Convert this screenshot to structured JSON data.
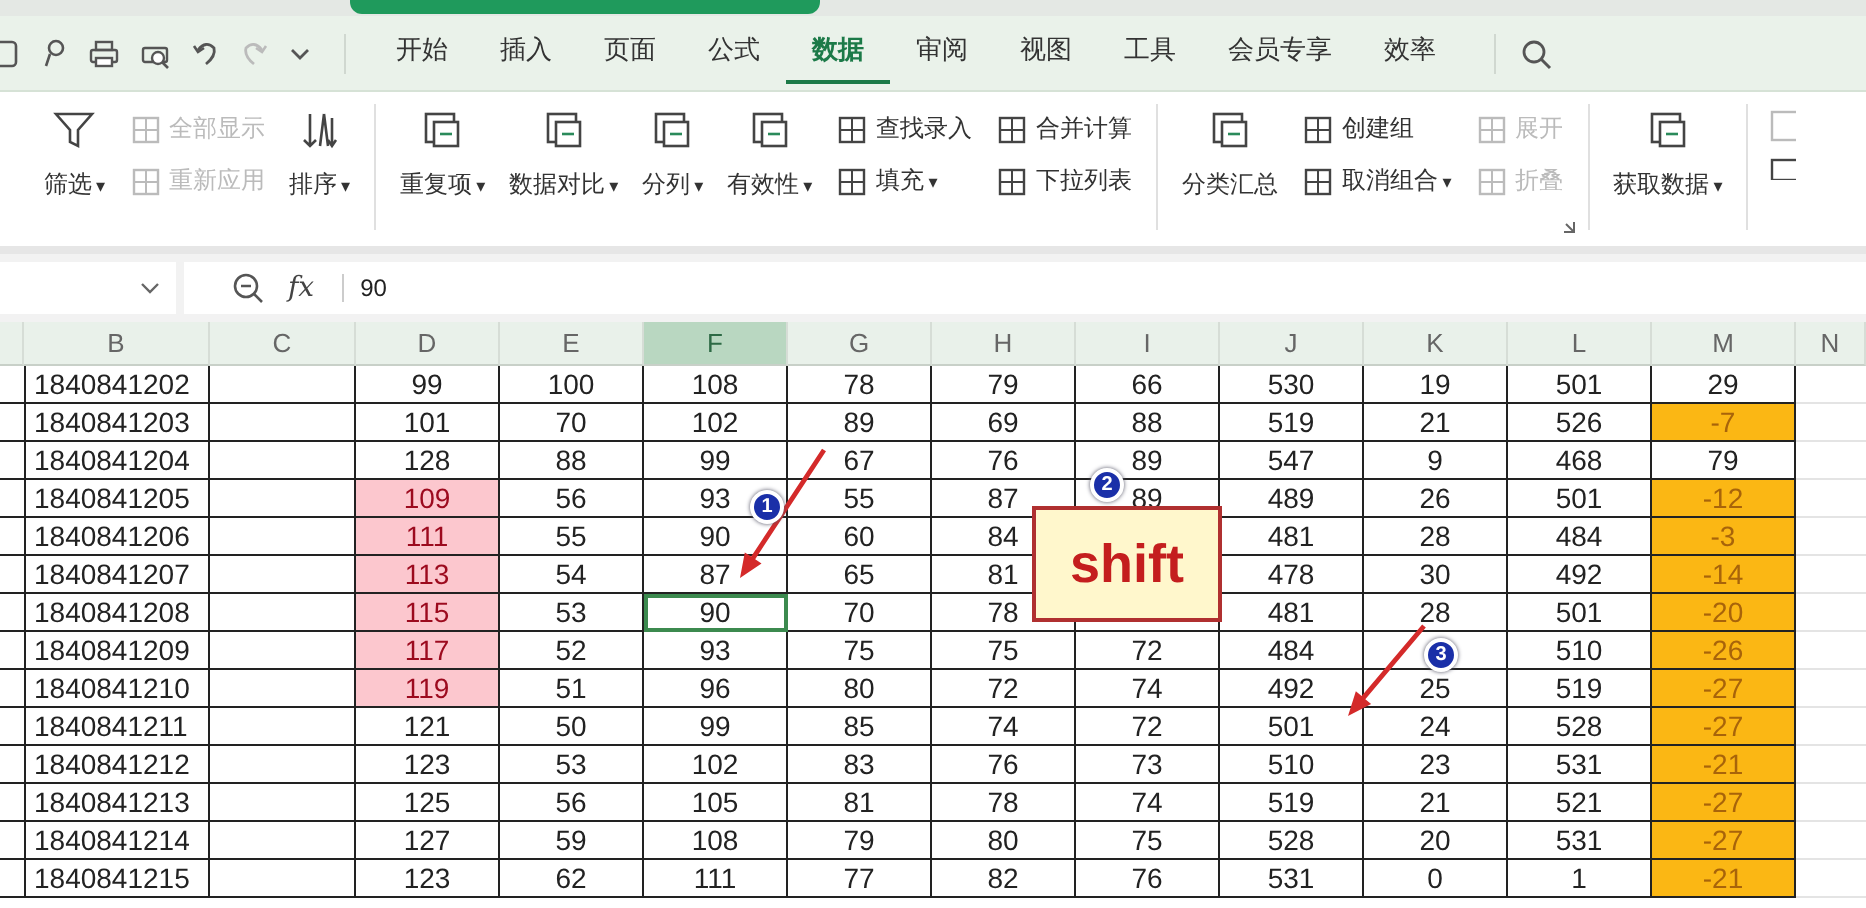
{
  "menu_tabs": [
    {
      "label": "开始",
      "selected": false
    },
    {
      "label": "插入",
      "selected": false
    },
    {
      "label": "页面",
      "selected": false
    },
    {
      "label": "公式",
      "selected": false
    },
    {
      "label": "数据",
      "selected": true
    },
    {
      "label": "审阅",
      "selected": false
    },
    {
      "label": "视图",
      "selected": false
    },
    {
      "label": "工具",
      "selected": false
    },
    {
      "label": "会员专享",
      "selected": false
    },
    {
      "label": "效率",
      "selected": false
    }
  ],
  "ribbon": [
    {
      "items": [
        {
          "kind": "large",
          "label": "筛选",
          "caret": "▾",
          "disabled": false
        },
        {
          "kind": "stack",
          "items": [
            {
              "label": "全部显示",
              "disabled": true
            },
            {
              "label": "重新应用",
              "disabled": true
            }
          ]
        },
        {
          "kind": "large",
          "label": "排序",
          "caret": "▾",
          "disabled": false
        }
      ]
    },
    {
      "items": [
        {
          "kind": "large",
          "label": "重复项",
          "caret": "▾",
          "disabled": false
        },
        {
          "kind": "large",
          "label": "数据对比",
          "caret": "▾",
          "disabled": false
        },
        {
          "kind": "large",
          "label": "分列",
          "caret": "▾",
          "disabled": false
        },
        {
          "kind": "large",
          "label": "有效性",
          "caret": "▾",
          "disabled": false
        },
        {
          "kind": "stack",
          "items": [
            {
              "label": "查找录入",
              "disabled": false
            },
            {
              "label": "填充",
              "caret": "▾",
              "disabled": false
            }
          ]
        },
        {
          "kind": "stack",
          "items": [
            {
              "label": "合并计算",
              "disabled": false
            },
            {
              "label": "下拉列表",
              "disabled": false
            }
          ]
        }
      ]
    },
    {
      "items": [
        {
          "kind": "large",
          "label": "分类汇总",
          "disabled": false
        },
        {
          "kind": "stack",
          "items": [
            {
              "label": "创建组",
              "disabled": false
            },
            {
              "label": "取消组合",
              "caret": "▾",
              "disabled": false
            }
          ]
        },
        {
          "kind": "stack",
          "items": [
            {
              "label": "展开",
              "disabled": true
            },
            {
              "label": "折叠",
              "disabled": true
            }
          ]
        }
      ]
    },
    {
      "items": [
        {
          "kind": "large",
          "label": "获取数据",
          "caret": "▾",
          "disabled": false
        }
      ]
    }
  ],
  "formula_bar": {
    "fx": "fx",
    "value": "90"
  },
  "columns": [
    {
      "label": "B",
      "selected": false
    },
    {
      "label": "C",
      "selected": false
    },
    {
      "label": "D",
      "selected": false
    },
    {
      "label": "E",
      "selected": false
    },
    {
      "label": "F",
      "selected": true
    },
    {
      "label": "G",
      "selected": false
    },
    {
      "label": "H",
      "selected": false
    },
    {
      "label": "I",
      "selected": false
    },
    {
      "label": "J",
      "selected": false
    },
    {
      "label": "K",
      "selected": false
    },
    {
      "label": "L",
      "selected": false
    },
    {
      "label": "M",
      "selected": false
    },
    {
      "label": "N",
      "selected": false
    }
  ],
  "rows": [
    {
      "cells": [
        "1840841202",
        "99",
        "100",
        "108",
        "78",
        "79",
        "66",
        "530",
        "19",
        "501",
        "29"
      ],
      "d_flagged": false,
      "m_flagged": false,
      "f_selected": false
    },
    {
      "cells": [
        "1840841203",
        "101",
        "70",
        "102",
        "89",
        "69",
        "88",
        "519",
        "21",
        "526",
        "-7"
      ],
      "d_flagged": false,
      "m_flagged": true,
      "f_selected": false
    },
    {
      "cells": [
        "1840841204",
        "128",
        "88",
        "99",
        "67",
        "76",
        "89",
        "547",
        "9",
        "468",
        "79"
      ],
      "d_flagged": false,
      "m_flagged": false,
      "f_selected": false
    },
    {
      "cells": [
        "1840841205",
        "109",
        "56",
        "93",
        "55",
        "87",
        "89",
        "489",
        "26",
        "501",
        "-12"
      ],
      "d_flagged": true,
      "m_flagged": true,
      "f_selected": false
    },
    {
      "cells": [
        "1840841206",
        "111",
        "55",
        "90",
        "60",
        "84",
        null,
        "481",
        "28",
        "484",
        "-3"
      ],
      "d_flagged": true,
      "m_flagged": true,
      "f_selected": false
    },
    {
      "cells": [
        "1840841207",
        "113",
        "54",
        "87",
        "65",
        "81",
        null,
        "478",
        "30",
        "492",
        "-14"
      ],
      "d_flagged": true,
      "m_flagged": true,
      "f_selected": false
    },
    {
      "cells": [
        "1840841208",
        "115",
        "53",
        "90",
        "70",
        "78",
        null,
        "481",
        "28",
        "501",
        "-20"
      ],
      "d_flagged": true,
      "m_flagged": true,
      "f_selected": true
    },
    {
      "cells": [
        "1840841209",
        "117",
        "52",
        "93",
        "75",
        "75",
        "72",
        "484",
        null,
        "510",
        "-26"
      ],
      "d_flagged": true,
      "m_flagged": true,
      "f_selected": false
    },
    {
      "cells": [
        "1840841210",
        "119",
        "51",
        "96",
        "80",
        "72",
        "74",
        "492",
        "25",
        "519",
        "-27"
      ],
      "d_flagged": true,
      "m_flagged": true,
      "f_selected": false
    },
    {
      "cells": [
        "1840841211",
        "121",
        "50",
        "99",
        "85",
        "74",
        "72",
        "501",
        "24",
        "528",
        "-27"
      ],
      "d_flagged": false,
      "m_flagged": true,
      "f_selected": false
    },
    {
      "cells": [
        "1840841212",
        "123",
        "53",
        "102",
        "83",
        "76",
        "73",
        "510",
        "23",
        "531",
        "-21"
      ],
      "d_flagged": false,
      "m_flagged": true,
      "f_selected": false
    },
    {
      "cells": [
        "1840841213",
        "125",
        "56",
        "105",
        "81",
        "78",
        "74",
        "519",
        "21",
        "521",
        "-27"
      ],
      "d_flagged": false,
      "m_flagged": true,
      "f_selected": false
    },
    {
      "cells": [
        "1840841214",
        "127",
        "59",
        "108",
        "79",
        "80",
        "75",
        "528",
        "20",
        "531",
        "-27"
      ],
      "d_flagged": false,
      "m_flagged": true,
      "f_selected": false
    },
    {
      "cells": [
        "1840841215",
        "123",
        "62",
        "111",
        "77",
        "82",
        "76",
        "531",
        "0",
        "1",
        "-21"
      ],
      "d_flagged": false,
      "m_flagged": true,
      "f_selected": false
    }
  ],
  "annotations": {
    "badges": [
      "1",
      "2",
      "3"
    ],
    "callout": "shift"
  }
}
